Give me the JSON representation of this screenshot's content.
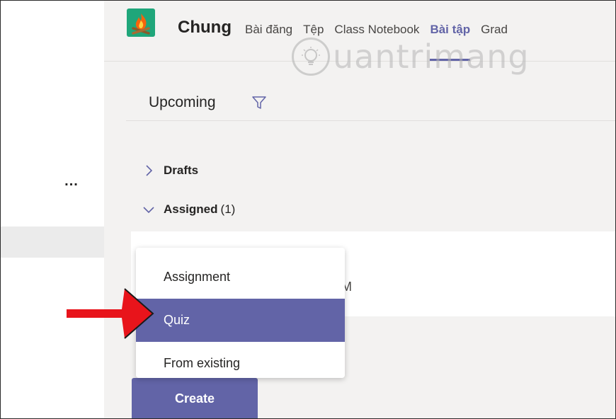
{
  "header": {
    "team_name": "Chung",
    "tabs": [
      {
        "label": "Bài đăng"
      },
      {
        "label": "Tệp"
      },
      {
        "label": "Class Notebook"
      },
      {
        "label": "Bài tập"
      },
      {
        "label": "Grad"
      }
    ],
    "active_tab": "Bài tập"
  },
  "watermark": {
    "text": "uantrimang"
  },
  "assignments": {
    "filter_label": "Upcoming",
    "groups": [
      {
        "label": "Drafts",
        "count": "",
        "expanded": false
      },
      {
        "label": "Assigned",
        "count": "(1)",
        "expanded": true
      }
    ],
    "card_partial_text": "M"
  },
  "create_menu": {
    "items": [
      {
        "label": "Assignment"
      },
      {
        "label": "Quiz"
      },
      {
        "label": "From existing"
      }
    ],
    "highlighted": "Quiz"
  },
  "create_button": {
    "label": "Create"
  },
  "left_rail": {
    "more_label": "..."
  },
  "colors": {
    "accent": "#6264a7",
    "team_icon_bg": "#1fa67a",
    "arrow": "#e8141b"
  },
  "icons": {
    "team": "campfire-icon",
    "filter": "filter-icon",
    "collapsed": "chevron-right-icon",
    "expanded": "chevron-down-icon"
  }
}
